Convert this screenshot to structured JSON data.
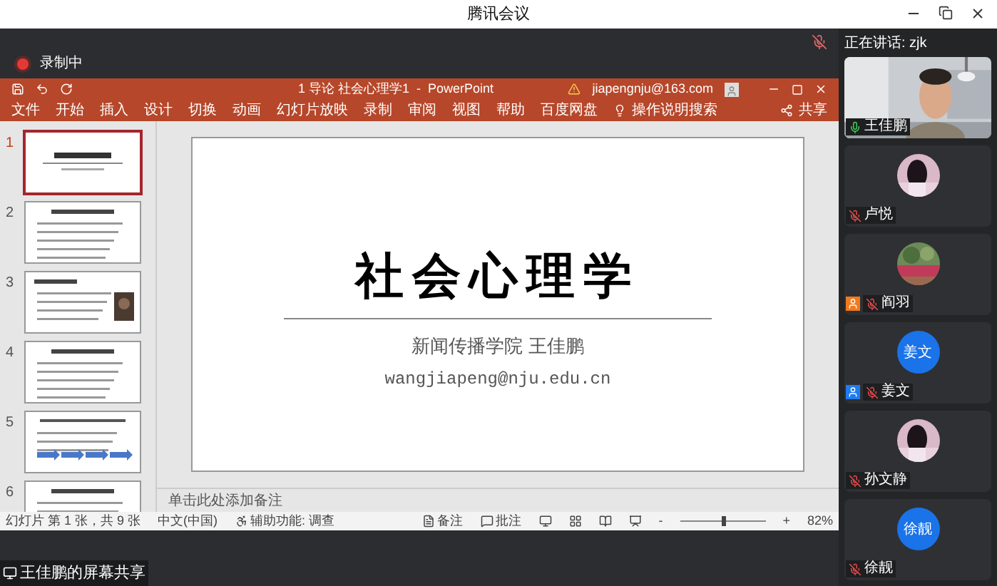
{
  "window": {
    "title": "腾讯会议"
  },
  "recording": {
    "label": "录制中",
    "on": true
  },
  "presenter_mic": {
    "muted": true
  },
  "ppt": {
    "title": "1 导论 社会心理学1  -  PowerPoint",
    "account": "jiapengnju@163.com",
    "tabs": [
      "文件",
      "开始",
      "插入",
      "设计",
      "切换",
      "动画",
      "幻灯片放映",
      "录制",
      "审阅",
      "视图",
      "帮助",
      "百度网盘"
    ],
    "search": "操作说明搜索",
    "share": "共享",
    "thumbnails": [
      {
        "number": "1",
        "selected": true,
        "kind": "title"
      },
      {
        "number": "2",
        "selected": false,
        "kind": "bullets"
      },
      {
        "number": "3",
        "selected": false
      },
      {
        "number": "4",
        "selected": false,
        "kind": "bullets"
      },
      {
        "number": "5",
        "selected": false,
        "kind": "arrows"
      },
      {
        "number": "6",
        "selected": false,
        "kind": "bullets"
      }
    ],
    "slide": {
      "title": "社会心理学",
      "subtitle": "新闻传播学院 王佳鹏",
      "email": "wangjiapeng@nju.edu.cn"
    },
    "notes_placeholder": "单击此处添加备注",
    "status": {
      "slide": "幻灯片 第 1 张，共 9 张",
      "language": "中文(中国)",
      "accessibility": "辅助功能: 调查",
      "notes": "备注",
      "comments": "批注",
      "zoom_minus": "-",
      "zoom_plus": "+",
      "zoom": "82%",
      "zoom_slider": {
        "level": 0.5
      }
    }
  },
  "share_label": "王佳鹏的屏幕共享",
  "speaking": "正在讲话: zjk",
  "participants": [
    {
      "name": "王佳鹏",
      "muted": false,
      "avatar": {
        "kind": "video"
      }
    },
    {
      "name": "卢悦",
      "muted": true
    },
    {
      "name": "阎羽",
      "muted": true,
      "badge": {
        "color": "#f07a1e"
      }
    },
    {
      "name": "姜文",
      "muted": true,
      "avatar": {
        "kind": "initials",
        "text": "姜文"
      },
      "badge": {
        "color": "#1f7cf0"
      }
    },
    {
      "name": "孙文静",
      "muted": true
    },
    {
      "name": "徐靓",
      "muted": true,
      "avatar": {
        "kind": "initials",
        "text": "徐靓"
      }
    }
  ]
}
